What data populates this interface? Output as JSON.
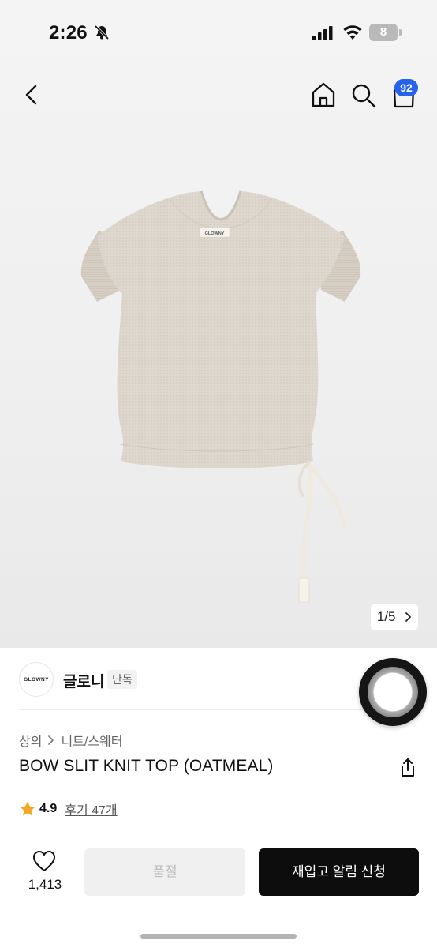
{
  "status": {
    "time": "2:26",
    "battery": "8"
  },
  "nav": {
    "cart_count": "92"
  },
  "image": {
    "pager": "1/5",
    "garment_label": "GLOWNY"
  },
  "brand": {
    "logo_text": "GLOWNY",
    "name": "글로니",
    "tag": "단독"
  },
  "breadcrumb": {
    "items": [
      "상의",
      "니트/스웨터"
    ]
  },
  "product": {
    "title": "BOW SLIT KNIT TOP (OATMEAL)"
  },
  "rating": {
    "score": "4.9",
    "reviews": "후기 47개"
  },
  "actions": {
    "like_count": "1,413",
    "soldout_label": "품절",
    "restock_label": "재입고 알림 신청"
  },
  "colors": {
    "accent_blue": "#2563eb",
    "star": "#f5a623",
    "primary_button": "#0d0d0d"
  },
  "icons": [
    "bell-off-icon",
    "signal-icon",
    "wifi-icon",
    "battery-icon",
    "back-icon",
    "home-icon",
    "search-icon",
    "cart-icon",
    "chevron-right-icon",
    "share-icon",
    "star-icon",
    "heart-icon"
  ]
}
